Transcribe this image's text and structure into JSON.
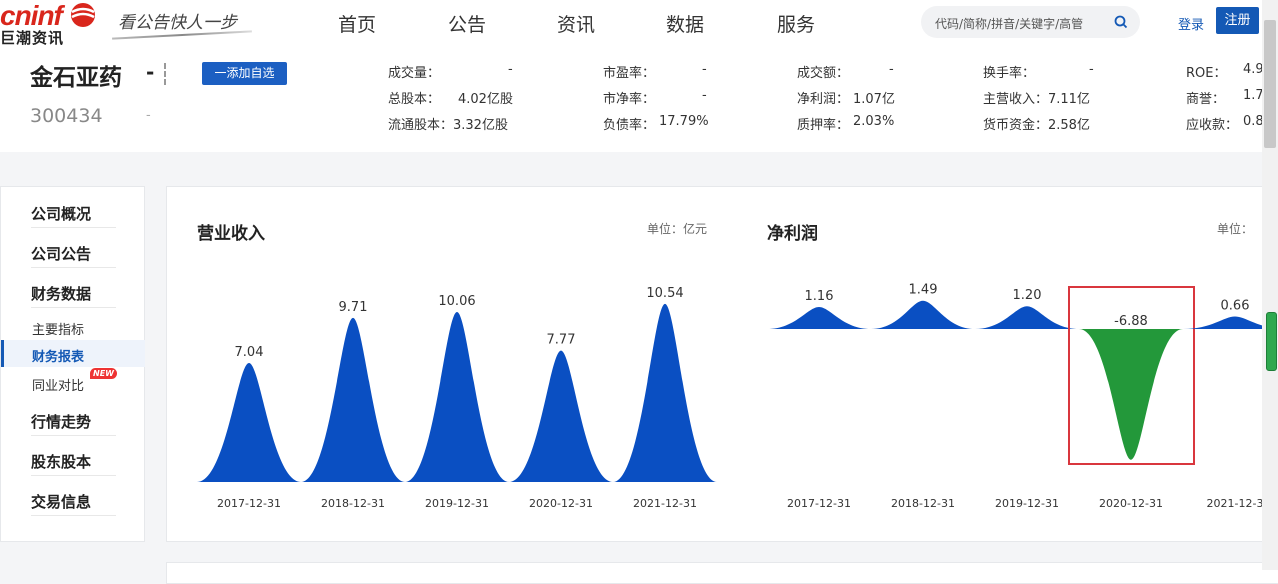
{
  "site": {
    "logo_text": "cninf",
    "logo_sub": "巨潮资讯",
    "slogan": "看公告快人一步",
    "nav": [
      "首页",
      "公告",
      "资讯",
      "数据",
      "服务"
    ],
    "search_placeholder": "代码/简称/拼音/关键字/高管",
    "login": "登录",
    "register": "注册"
  },
  "company": {
    "name": "金石亚药",
    "dash": "-",
    "code": "300434",
    "code_dash": "-",
    "add_button": "一添加自选"
  },
  "metrics": [
    [
      "成交量：",
      "-"
    ],
    [
      "总股本：",
      "4.02亿股"
    ],
    [
      "流通股本：",
      "3.32亿股"
    ],
    [
      "市盈率：",
      "-"
    ],
    [
      "市净率：",
      "-"
    ],
    [
      "负债率：",
      "17.79%"
    ],
    [
      "成交额：",
      "-"
    ],
    [
      "净利润：",
      "1.07亿"
    ],
    [
      "质押率：",
      "2.03%"
    ],
    [
      "换手率：",
      "-"
    ],
    [
      "主营收入：",
      "7.11亿"
    ],
    [
      "货币资金：",
      "2.58亿"
    ],
    [
      "ROE：",
      "4.9"
    ],
    [
      "商誉：",
      "1.7"
    ],
    [
      "应收款：",
      "0.8"
    ]
  ],
  "sidebar": {
    "main": [
      "公司概况",
      "公司公告",
      "财务数据"
    ],
    "sub": [
      "主要指标",
      "财务报表",
      "同业对比"
    ],
    "new_badge": "NEW",
    "main2": [
      "行情走势",
      "股东股本",
      "交易信息"
    ]
  },
  "colors": {
    "brand": "#1459b5",
    "positive": "#0a4fc2",
    "negative": "#23983a",
    "highlight": "#d9363e"
  },
  "chart_data": [
    {
      "type": "area",
      "title": "营业收入",
      "unit": "单位：亿元",
      "categories": [
        "2017-12-31",
        "2018-12-31",
        "2019-12-31",
        "2020-12-31",
        "2021-12-31"
      ],
      "values": [
        7.04,
        9.71,
        10.06,
        7.77,
        10.54
      ],
      "labels": [
        "7.04",
        "9.71",
        "10.06",
        "7.77",
        "10.54"
      ]
    },
    {
      "type": "area",
      "title": "净利润",
      "unit": "单位：",
      "categories": [
        "2017-12-31",
        "2018-12-31",
        "2019-12-31",
        "2020-12-31",
        "2021-12-3"
      ],
      "values": [
        1.16,
        1.49,
        1.2,
        -6.88,
        0.66
      ],
      "labels": [
        "1.16",
        "1.49",
        "1.20",
        "-6.88",
        "0.66"
      ],
      "highlighted_category": "2020-12-31"
    }
  ]
}
